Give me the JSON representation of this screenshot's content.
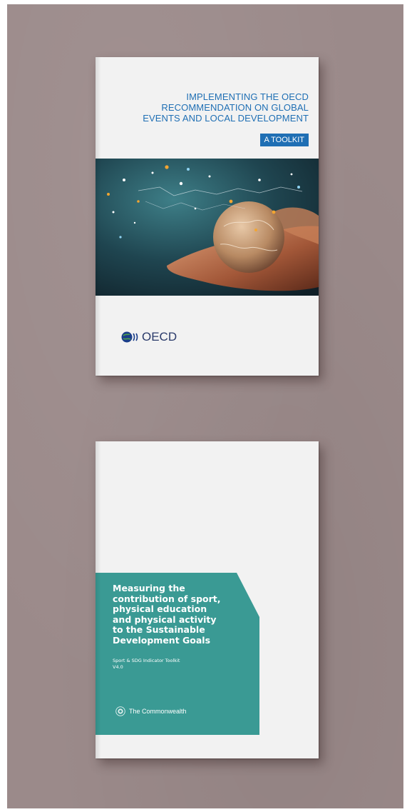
{
  "oecd_cover": {
    "title_lines": [
      "IMPLEMENTING THE OECD",
      "RECOMMENDATION ON GLOBAL",
      "EVENTS AND LOCAL DEVELOPMENT"
    ],
    "badge": "A TOOLKIT",
    "logo_text": "OECD",
    "accent_color": "#1f6fb4",
    "image_description_icon": "globe-in-hands-icon"
  },
  "commonwealth_cover": {
    "title_lines": [
      "Measuring the",
      "contribution of sport,",
      "physical education",
      "and physical activity",
      "to the Sustainable",
      "Development Goals"
    ],
    "subtitle_lines": [
      "Sport & SDG Indicator Toolkit",
      "V4.0"
    ],
    "logo_text": "The Commonwealth",
    "panel_color": "#3a9a94",
    "logo_icon": "commonwealth-emblem-icon"
  },
  "colors": {
    "wall": "#9b8a8a",
    "paper": "#f2f2f2"
  }
}
